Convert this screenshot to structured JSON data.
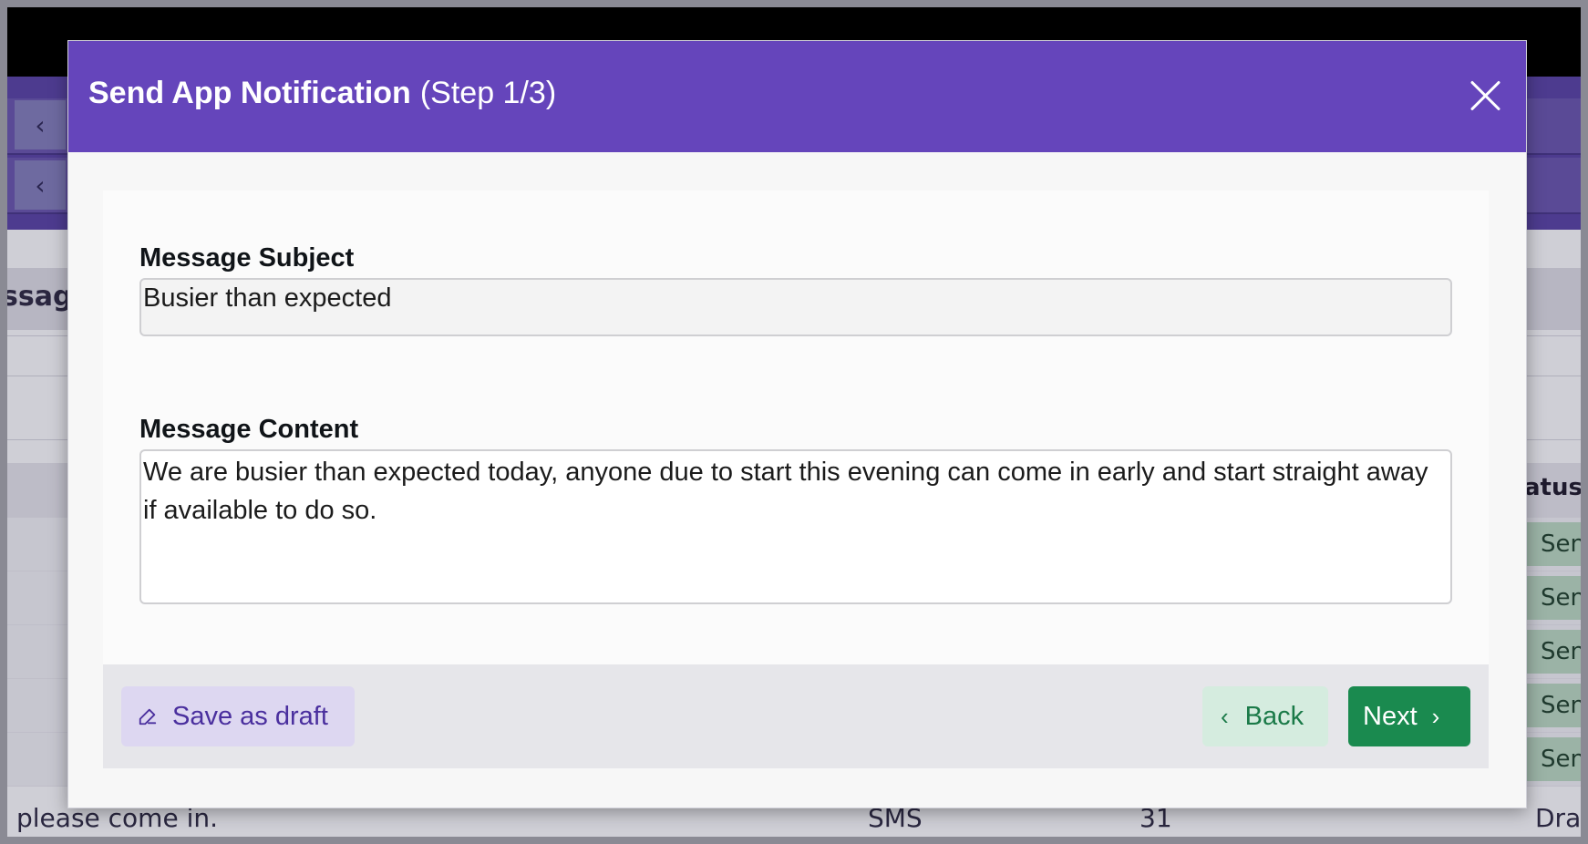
{
  "modal": {
    "title": "Send App Notification",
    "step": "(Step 1/3)",
    "subject_label": "Message Subject",
    "subject_value": "Busier than expected",
    "content_label": "Message Content",
    "content_value": "We are busier than expected today, anyone due to start this evening can come in early and start straight away if available to do so.",
    "save_draft_label": "Save as draft",
    "back_label": "Back",
    "next_label": "Next"
  },
  "background": {
    "section_title_partial": "ssag",
    "status_header_partial": "atus",
    "status_cells": [
      "Sen",
      "Sen",
      "Sen",
      "Sen",
      "Sen"
    ],
    "last_row": {
      "message": "please come in.",
      "type": "SMS",
      "count": "31",
      "status": "Dra"
    }
  },
  "colors": {
    "header": "#6545bb",
    "next_button": "#1a8a4f",
    "back_button_bg": "#d5ecdf",
    "draft_button_bg": "#ddd7f1"
  },
  "icons": {
    "close": "close-icon",
    "draft": "pencil-icon",
    "back": "chevron-left-icon",
    "next": "chevron-right-icon"
  }
}
